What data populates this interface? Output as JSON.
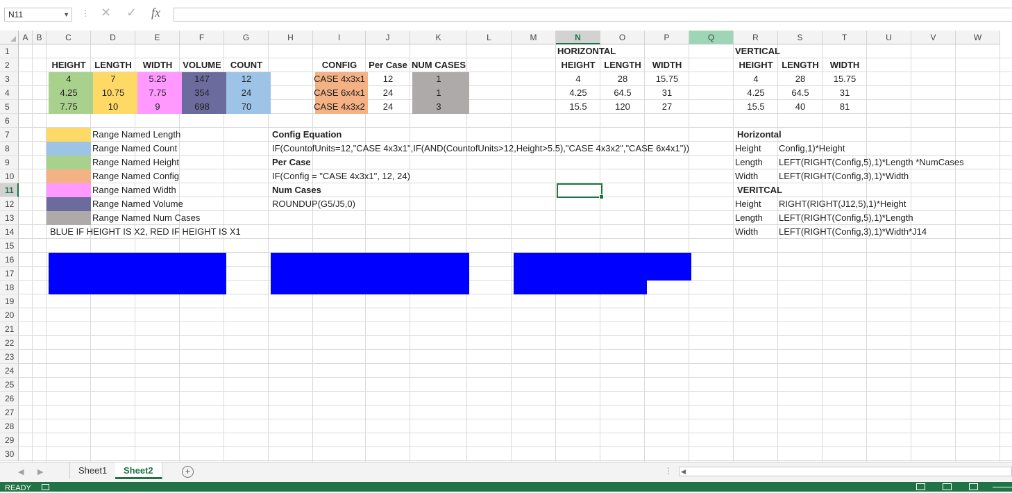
{
  "formula_bar": {
    "name_box": "N11",
    "formula": "",
    "fx_label": "fx",
    "cancel_glyph": "✕",
    "enter_glyph": "✓",
    "dots": "⋮"
  },
  "columns": [
    "A",
    "B",
    "C",
    "D",
    "E",
    "F",
    "G",
    "H",
    "I",
    "J",
    "K",
    "L",
    "M",
    "N",
    "O",
    "P",
    "Q",
    "R",
    "S",
    "T",
    "U",
    "V",
    "W"
  ],
  "rows": [
    "1",
    "2",
    "3",
    "4",
    "5",
    "6",
    "7",
    "8",
    "9",
    "10",
    "11",
    "12",
    "13",
    "14",
    "15",
    "16",
    "17",
    "18",
    "19",
    "20",
    "21",
    "22",
    "23",
    "24",
    "25",
    "26",
    "27",
    "28",
    "29",
    "30"
  ],
  "selected": {
    "column": "N",
    "row": "11"
  },
  "table1": {
    "headers": [
      "HEIGHT",
      "LENGTH",
      "WIDTH",
      "VOLUME",
      "COUNT"
    ],
    "rows": [
      [
        "4",
        "7",
        "5.25",
        "147",
        "12"
      ],
      [
        "4.25",
        "10.75",
        "7.75",
        "354",
        "24"
      ],
      [
        "7.75",
        "10",
        "9",
        "698",
        "70"
      ]
    ]
  },
  "table2": {
    "headers": [
      "CONFIG",
      "Per Case",
      "NUM CASES"
    ],
    "rows": [
      [
        "CASE 4x3x1",
        "12",
        "1"
      ],
      [
        "CASE 6x4x1",
        "24",
        "1"
      ],
      [
        "CASE 4x3x2",
        "24",
        "3"
      ]
    ]
  },
  "horizontal": {
    "title": "HORIZONTAL",
    "headers": [
      "HEIGHT",
      "LENGTH",
      "WIDTH"
    ],
    "rows": [
      [
        "4",
        "28",
        "15.75"
      ],
      [
        "4.25",
        "64.5",
        "31"
      ],
      [
        "15.5",
        "120",
        "27"
      ]
    ]
  },
  "vertical": {
    "title": "VERTICAL",
    "headers": [
      "HEIGHT",
      "LENGTH",
      "WIDTH"
    ],
    "rows": [
      [
        "4",
        "28",
        "15.75"
      ],
      [
        "4.25",
        "64.5",
        "31"
      ],
      [
        "15.5",
        "40",
        "81"
      ]
    ]
  },
  "legend": [
    {
      "label": "Range Named Length",
      "color": "#ffd966"
    },
    {
      "label": "Range Named Count",
      "color": "#9dc3e6"
    },
    {
      "label": "Range Named Height",
      "color": "#a9d18e"
    },
    {
      "label": "Range Named Config",
      "color": "#f4b183"
    },
    {
      "label": "Range Named Width",
      "color": "#ff99ff"
    },
    {
      "label": "Range Named Volume",
      "color": "#6b6b9e"
    },
    {
      "label": "Range Named Num Cases",
      "color": "#aeaaaa"
    }
  ],
  "note": "BLUE IF HEIGHT IS X2, RED IF HEIGHT IS X1",
  "equations": {
    "config_title": "Config Equation",
    "config_formula": "IF(CountofUnits=12,\"CASE 4x3x1\",IF(AND(CountofUnits>12,Height>5.5),\"CASE 4x3x2\",\"CASE 6x4x1\"))",
    "per_case_title": "Per Case",
    "per_case_formula": "IF(Config = \"CASE 4x3x1\", 12, 24)",
    "num_cases_title": "Num Cases",
    "num_cases_formula": "ROUNDUP(G5/J5,0)"
  },
  "notes_right": {
    "horizontal_title": "Horizontal",
    "horizontal": [
      [
        "Height",
        "Config,1)*Height"
      ],
      [
        "Length",
        "LEFT(RIGHT(Config,5),1)*Length *NumCases"
      ],
      [
        "Width",
        "LEFT(RIGHT(Config,3),1)*Width"
      ]
    ],
    "vertical_title": "VERITCAL",
    "vertical": [
      [
        "Height",
        "RIGHT(RIGHT(J12,5),1)*Height"
      ],
      [
        "Length",
        "LEFT(RIGHT(Config,5),1)*Length"
      ],
      [
        "Width",
        "LEFT(RIGHT(Config,3),1)*Width*J14"
      ]
    ]
  },
  "colors": {
    "blue_fill": "#0000ff",
    "excel_green": "#217346",
    "height": "#a9d18e",
    "length": "#ffd966",
    "width": "#ff99ff",
    "volume": "#6b6b9e",
    "count": "#9dc3e6",
    "config": "#f4b183",
    "num_cases": "#aeaaaa"
  },
  "sheet_tabs": [
    "Sheet1",
    "Sheet2"
  ],
  "active_sheet": "Sheet2",
  "status": {
    "ready": "READY"
  }
}
